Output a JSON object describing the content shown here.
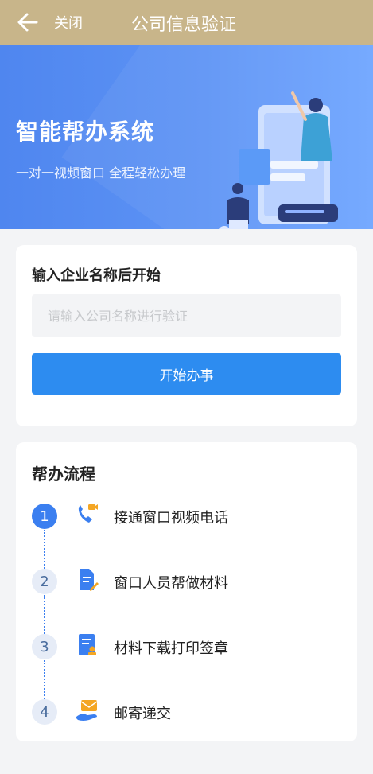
{
  "header": {
    "close_label": "关闭",
    "title": "公司信息验证",
    "back_icon": "arrow-left-icon",
    "bg_color": "#c8b58a"
  },
  "banner": {
    "title": "智能帮办系统",
    "subtitle": "一对一视频窗口 全程轻松办理",
    "bg_color": "#5a8ff3"
  },
  "company_form": {
    "label": "输入企业名称后开始",
    "input_value": "",
    "input_placeholder": "请输入公司名称进行验证",
    "start_button": "开始办事",
    "button_color": "#2d8cf0"
  },
  "process": {
    "title": "帮办流程",
    "steps": [
      {
        "number": "1",
        "label": "接通窗口视频电话",
        "icon": "phone-video-icon",
        "active": true
      },
      {
        "number": "2",
        "label": "窗口人员帮做材料",
        "icon": "document-edit-icon",
        "active": false
      },
      {
        "number": "3",
        "label": "材料下载打印签章",
        "icon": "document-stamp-icon",
        "active": false
      },
      {
        "number": "4",
        "label": "邮寄递交",
        "icon": "mail-hand-icon",
        "active": false
      }
    ]
  }
}
